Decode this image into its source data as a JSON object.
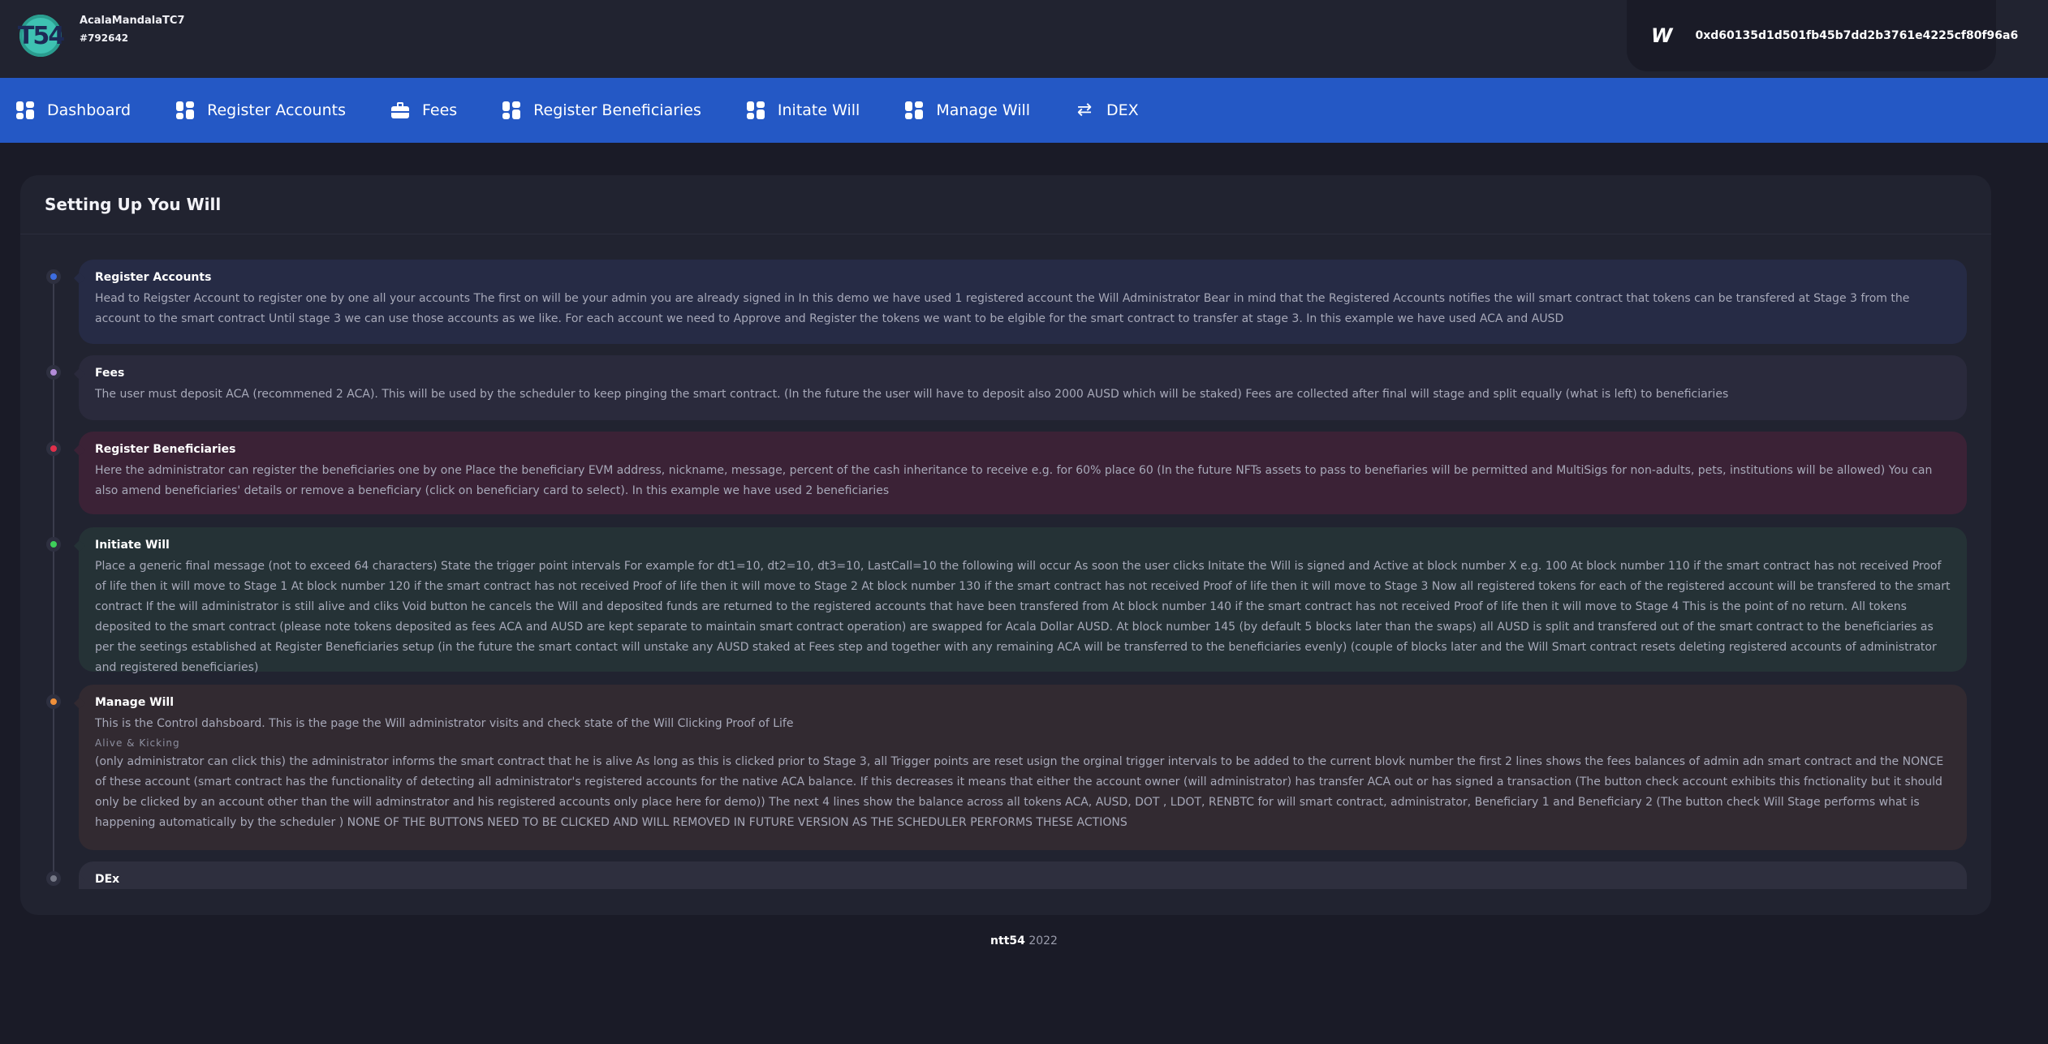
{
  "header": {
    "logo_text": "T54",
    "username": "AcalaMandalaTC7",
    "user_id": "#792642",
    "wallet_icon": "W",
    "wallet_address": "0xd60135d1d501fb45b7dd2b3761e4225cf80f96a6"
  },
  "nav": {
    "items": [
      {
        "label": "Dashboard",
        "icon": "grid-icon"
      },
      {
        "label": "Register Accounts",
        "icon": "grid-icon"
      },
      {
        "label": "Fees",
        "icon": "briefcase-icon"
      },
      {
        "label": "Register Beneficiaries",
        "icon": "grid-icon"
      },
      {
        "label": "Initate Will",
        "icon": "grid-icon"
      },
      {
        "label": "Manage Will",
        "icon": "grid-icon"
      },
      {
        "label": "DEX",
        "icon": "swap-icon"
      }
    ]
  },
  "main": {
    "title": "Setting Up You Will",
    "steps": [
      {
        "title": "Register Accounts",
        "dot_color": "#3d6de0",
        "body": "Head to Reigster Account to register one by one all your accounts The first on will be your admin you are already signed in In this demo we have used 1 registered account the Will Administrator Bear in mind that the Registered Accounts notifies the will smart contract that tokens can be transfered at Stage 3 from the account to the smart contract Until stage 3 we can use those accounts as we like. For each account we need to Approve and Register the tokens we want to be elgible for the smart contract to transfer at stage 3. In this example we have used ACA and AUSD"
      },
      {
        "title": "Fees",
        "dot_color": "#b38cd9",
        "body": "The user must deposit ACA (recommened 2 ACA). This will be used by the scheduler to keep pinging the smart contract. (In the future the user will have to deposit also 2000 AUSD which will be staked) Fees are collected after final will stage and split equally (what is left) to beneficiaries"
      },
      {
        "title": "Register Beneficiaries",
        "dot_color": "#e0304b",
        "body": "Here the administrator can register the beneficiaries one by one Place the beneficiary EVM address, nickname, message, percent of the cash inheritance to receive e.g. for 60% place 60 (In the future NFTs assets to pass to benefiaries will be permitted and MultiSigs for non-adults, pets, institutions will be allowed) You can also amend beneficiaries' details or remove a beneficiary (click on beneficiary card to select). In this example we have used 2 beneficiaries"
      },
      {
        "title": "Initiate Will",
        "dot_color": "#3ecf5a",
        "body": "Place a generic final message (not to exceed 64 characters) State the trigger point intervals For example for dt1=10, dt2=10, dt3=10, LastCall=10 the following will occur As soon the user clicks Initate the Will is signed and Active at block number X e.g. 100 At block number 110 if the smart contract has not received Proof of life then it will move to Stage 1 At block number 120 if the smart contract has not received Proof of life then it will move to Stage 2 At block number 130 if the smart contract has not received Proof of life then it will move to Stage 3 Now all registered tokens for each of the registered account will be transfered to the smart contract If the will administrator is still alive and cliks Void button he cancels the Will and deposited funds are returned to the registered accounts that have been transfered from At block number 140 if the smart contract has not received Proof of life then it will move to Stage 4 This is the point of no return. All tokens deposited to the smart contract (please note tokens deposited as fees ACA and AUSD are kept separate to maintain smart contract operation) are swapped for Acala Dollar AUSD. At block number 145 (by default 5 blocks later than the swaps) all AUSD is split and transfered out of the smart contract to the beneficiaries as per the seetings established at Register Beneficiaries setup (in the future the smart contact will unstake any AUSD staked at Fees step and together with any remaining ACA will be transferred to the beneficiaries evenly) (couple of blocks later and the Will Smart contract resets deleting registered accounts of administrator and registered beneficiaries)"
      },
      {
        "title": "Manage Will",
        "dot_color": "#f0903a",
        "body": "This is the Control dahsboard. This is the page the Will administrator visits and check state of the Will Clicking Proof of Life",
        "note": "Alive & Kicking",
        "body2": "(only administrator can click this) the administrator informs the smart contract that he is alive As long as this is clicked prior to Stage 3, all Trigger points are reset usign the orginal trigger intervals to be added to the current blovk number the first 2 lines shows the fees balances of admin adn smart contract and the NONCE of these account (smart contract has the functionality of detecting all administrator's registered accounts for the native ACA balance. If this decreases it means that either the account owner (will administrator) has transfer ACA out or has signed a transaction (The button check account exhibits this fnctionality but it should only be clicked by an account other than the will adminstrator and his registered accounts only place here for demo)) The next 4 lines show the balance across all tokens ACA, AUSD, DOT , LDOT, RENBTC for will smart contract, administrator, Beneficiary 1 and Beneficiary 2 (The button check Will Stage performs what is happening automatically by the scheduler ) NONE OF THE BUTTONS NEED TO BE CLICKED AND WILL REMOVED IN FUTURE VERSION AS THE SCHEDULER PERFORMS THESE ACTIONS"
      },
      {
        "title": "DEx",
        "dot_color": "#777a88",
        "body": ""
      }
    ]
  },
  "footer": {
    "brand": "ntt54",
    "year": "2022"
  },
  "colors": {
    "nav_bg": "#2458c5",
    "page_bg": "#1a1b27",
    "card_bg": "#212330"
  }
}
